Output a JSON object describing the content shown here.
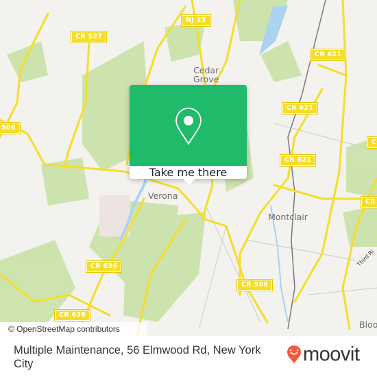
{
  "map": {
    "road_labels": [
      "NJ 23",
      "CR 527",
      "CR 621",
      "CR 621",
      "CR 621",
      "506",
      "CR 636",
      "CR 506",
      "CR 636",
      "CR",
      "C"
    ],
    "places": {
      "cedar_grove": "Cedar\nGrove",
      "verona": "Verona",
      "montclair": "Montclair",
      "bloomfield": "Bloo",
      "third_river": "Third Ri"
    },
    "attribution": "© OpenStreetMap contributors",
    "colors": {
      "land": "#f3f2ee",
      "park": "#c9e2a6",
      "water": "#a9d3ef",
      "road": "#f5dd2a"
    }
  },
  "popup": {
    "icon": "map-pin-icon",
    "button_label": "Take me there",
    "color": "#1fba6a"
  },
  "footer": {
    "title": "Multiple Maintenance, 56 Elmwood Rd, New York City",
    "brand": "moovit",
    "brand_color": "#f15a3b"
  }
}
